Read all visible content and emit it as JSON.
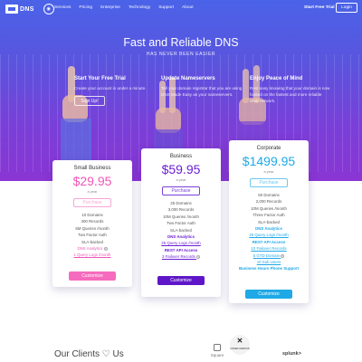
{
  "nav": {
    "logo_text": "DNS",
    "menu": [
      "Services",
      "Pricing",
      "Enterprise",
      "Technology",
      "Support",
      "About"
    ],
    "start_label": "Start Free Trial",
    "login_label": "Login"
  },
  "hero": {
    "title": "Fast and Reliable DNS",
    "subtitle": "HAS NEVER BEEN EASIER"
  },
  "columns": [
    {
      "title": "Start Your Free Trial",
      "text": "Create your account in under a minute.",
      "button": "Sign Up!"
    },
    {
      "title": "Update Nameservers",
      "text": "Tell your domain registrar that you are using DNS Made Easy as your nameservers.",
      "button": ""
    },
    {
      "title": "Enjoy Peace of Mind",
      "text": "Rest easy knowing that your domain is now hosted on the fastest and more reliable DNS network.",
      "button": ""
    }
  ],
  "plans": [
    {
      "name": "Small Business",
      "price": "$29.95",
      "period": "a year",
      "purchase": "Purchase",
      "features": [
        "10 Domains",
        "400 Records",
        "5M Queries /month",
        "Two Factor Auth",
        "SLA-backed"
      ],
      "links": [
        "DNS Analytics",
        "1 Query Logs /month"
      ],
      "customize": "Customize",
      "color": "#f56bbd"
    },
    {
      "name": "Business",
      "price": "$59.95",
      "period": "a year",
      "purchase": "Purchase",
      "features": [
        "25 Domains",
        "3,000 Records",
        "10M Queries /month",
        "Two Factor Auth",
        "SLA-backed"
      ],
      "links": [
        "DNS Analytics",
        "25 Query Logs /month",
        "REST API Access",
        "3 Failover Records"
      ],
      "customize": "Customize",
      "color": "#6a1fd6"
    },
    {
      "name": "Corporate",
      "price": "$1499.95",
      "period": "a year",
      "purchase": "Purchase",
      "features": [
        "50 Domains",
        "2,000 Records",
        "10M Queries /month",
        "Three Factor Auth",
        "SLA-backed"
      ],
      "links": [
        "DNS Analytics",
        "25 Query Logs /month",
        "REST API Access",
        "10 Failover Records",
        "5 GTD Domain",
        "10 Sub Users",
        "Business Hours Phone Support"
      ],
      "customize": "Customize",
      "color": "#1fa9e6"
    }
  ],
  "clients": {
    "title": "Our Clients ♡ Us",
    "logos": [
      "Square",
      "UNDER ARMOUR",
      "splunk>"
    ]
  },
  "icons": {
    "logo": "dns-logo-icon",
    "badge": "dns-badge-icon",
    "help": "question-icon",
    "heart": "heart-icon"
  }
}
